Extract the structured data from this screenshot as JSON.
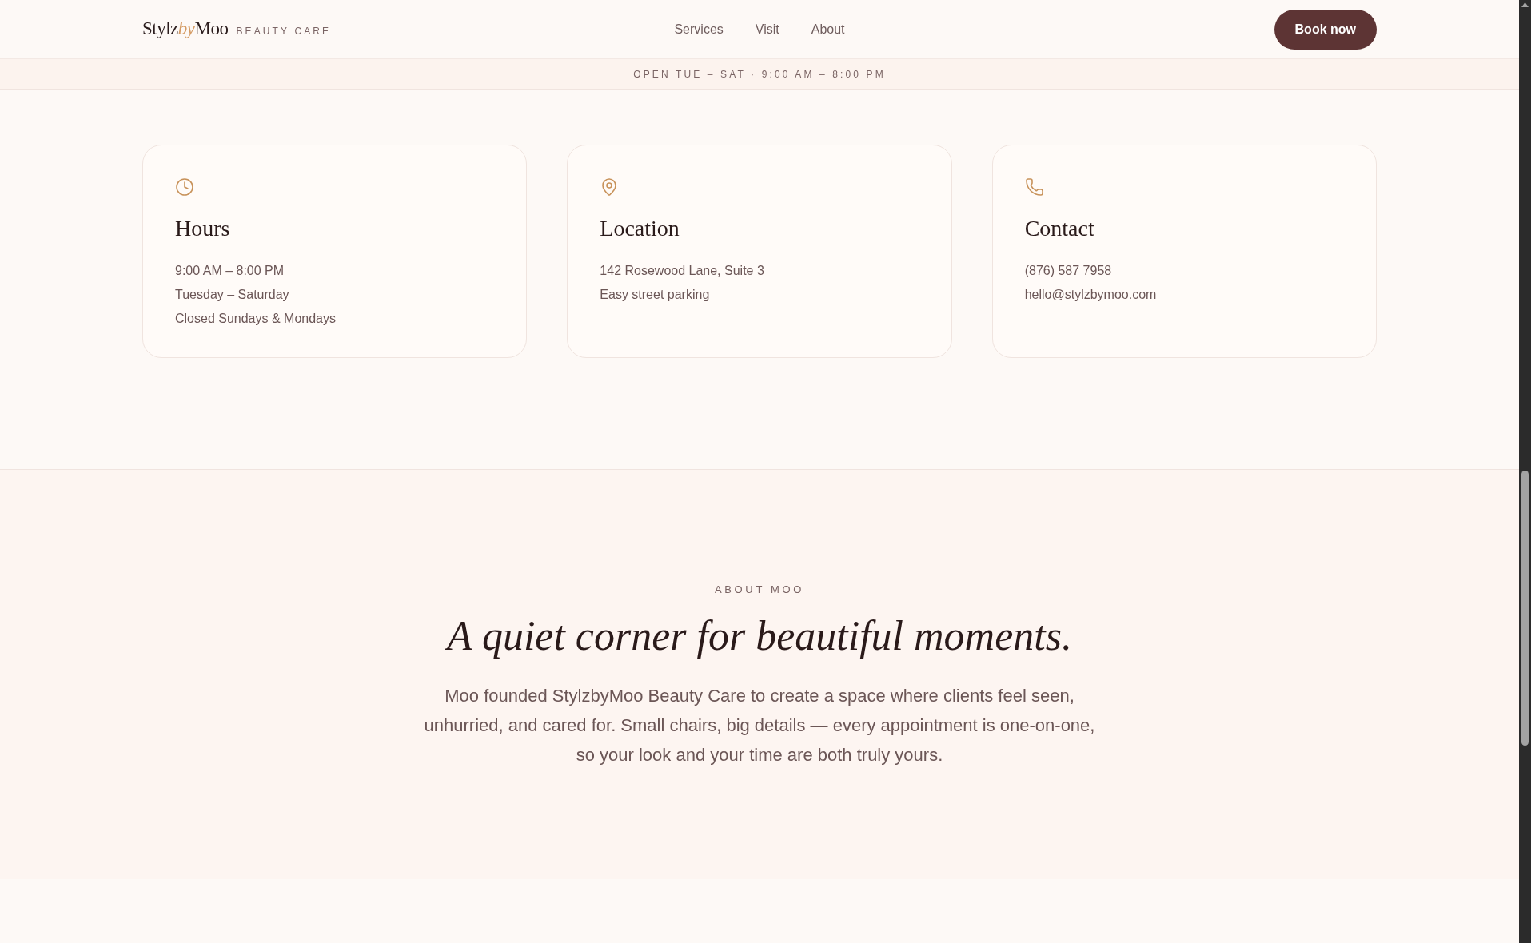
{
  "header": {
    "logo": {
      "name_start": "Stylz",
      "name_accent": "by",
      "name_end": "Moo",
      "tagline": "BEAUTY CARE"
    },
    "nav": [
      "Services",
      "Visit",
      "About"
    ],
    "cta": "Book now"
  },
  "hours_bar": "OPEN TUE – SAT · 9:00 AM – 8:00 PM",
  "info_cards": [
    {
      "kind": "hours",
      "title": "Hours",
      "lines": [
        "9:00 AM – 8:00 PM",
        "Tuesday – Saturday",
        "Closed Sundays & Mondays"
      ]
    },
    {
      "kind": "location",
      "title": "Location",
      "lines": [
        "142 Rosewood Lane, Suite 3",
        "Easy street parking"
      ]
    },
    {
      "kind": "contact",
      "title": "Contact",
      "lines": [
        "(876) 587 7958",
        "hello@stylzbymoo.com"
      ]
    }
  ],
  "about": {
    "eyebrow": "ABOUT MOO",
    "heading": "A quiet corner for beautiful moments.",
    "body": "Moo founded StylzbyMoo Beauty Care to create a space where clients feel seen, unhurried, and cared for. Small chairs, big details — every appointment is one-on-one, so your look and your time are both truly yours."
  }
}
